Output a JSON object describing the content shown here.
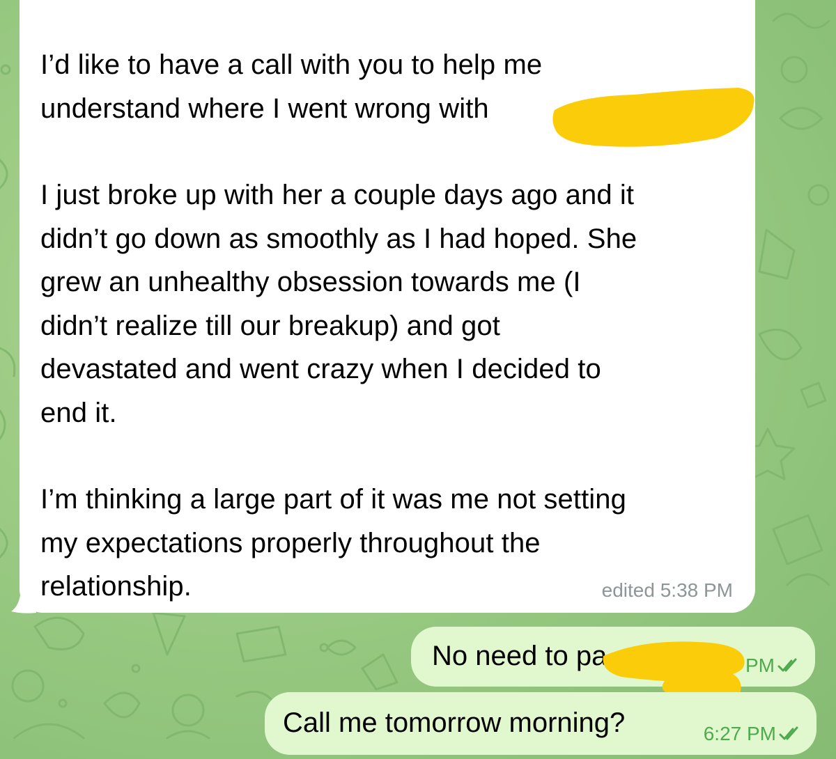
{
  "chat": {
    "messages": [
      {
        "direction": "incoming",
        "paragraph_1": "I’d like to have a call with you to help me\nunderstand where I went wrong with",
        "paragraph_2": "I just broke up with her a couple days ago and it\ndidn’t go down as smoothly as I had hoped. She\ngrew an unhealthy obsession towards me (I\ndidn’t realize till our breakup) and got\ndevastated and went crazy when I decided to\nend it.",
        "paragraph_3": "I’m thinking a large part of it was me not setting\nmy expectations properly throughout the\nrelationship.",
        "meta": "edited 5:38 PM"
      },
      {
        "direction": "outgoing",
        "text": "No need to pa",
        "time": "PM",
        "status": "read",
        "status_icon": "double-check-icon"
      },
      {
        "direction": "outgoing",
        "text": "Call me tomorrow morning?",
        "time": "6:27 PM",
        "status": "read",
        "status_icon": "double-check-icon"
      }
    ]
  },
  "colors": {
    "wallpaper": "#9ccb84",
    "incoming_bubble": "#ffffff",
    "outgoing_bubble": "#e1f8cf",
    "outgoing_meta": "#4faa4d",
    "incoming_meta": "#8e9596",
    "redaction": "#fbcc0a"
  }
}
